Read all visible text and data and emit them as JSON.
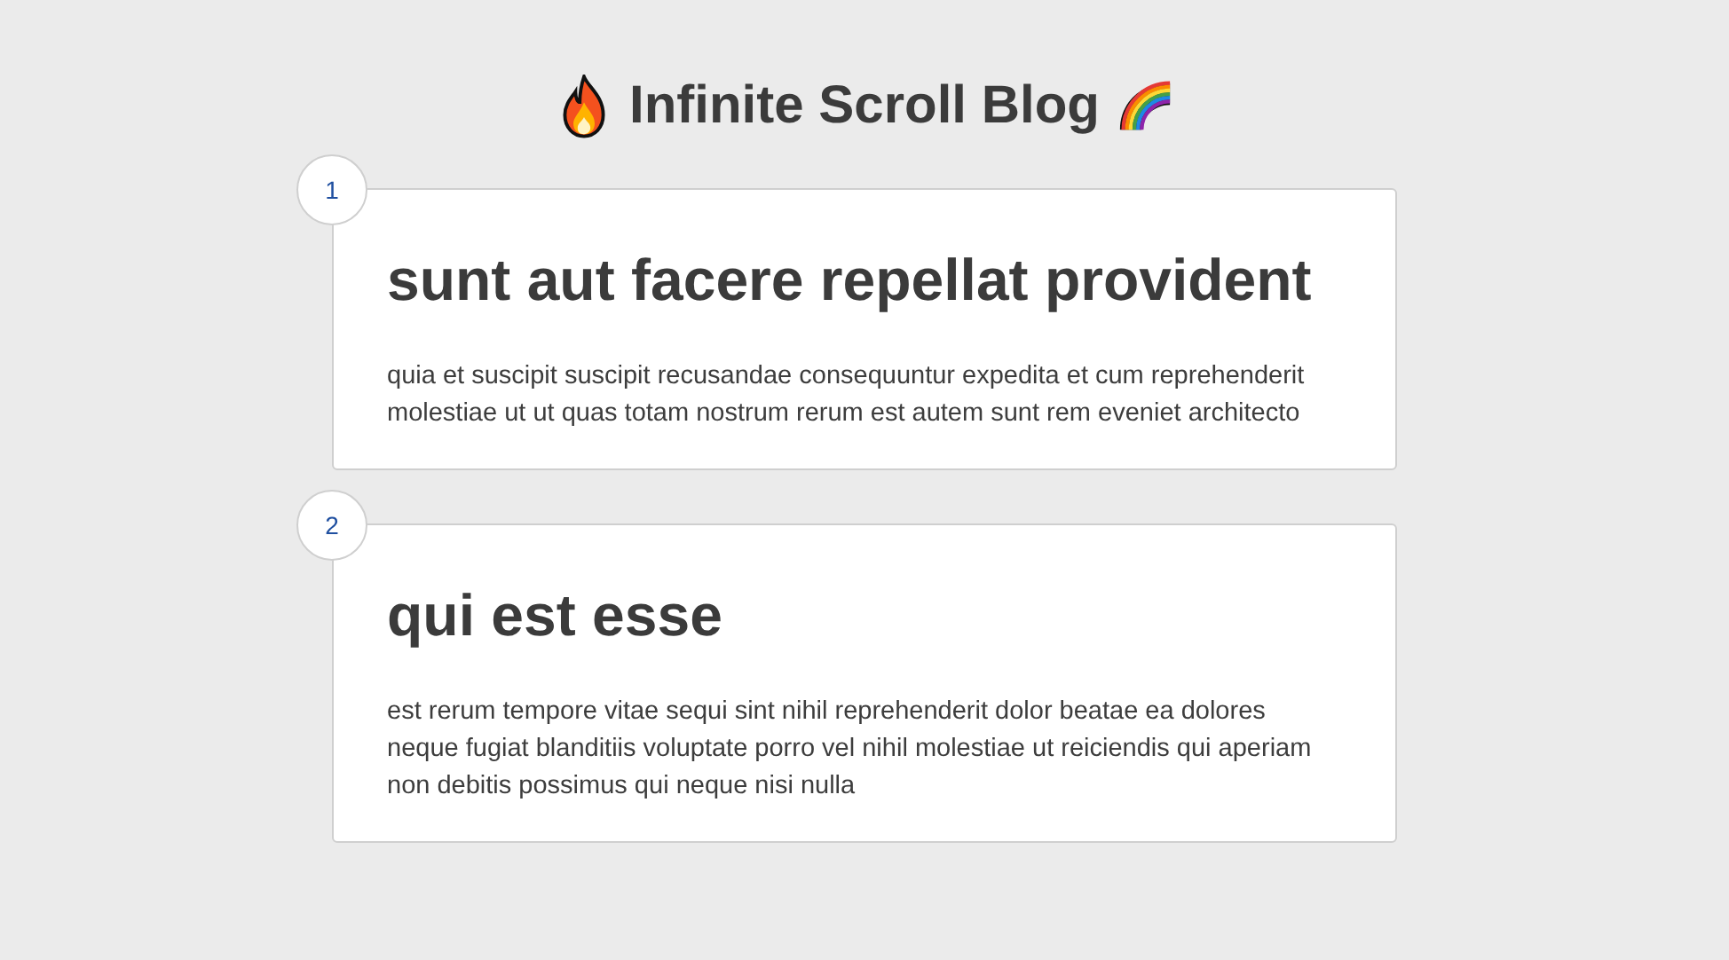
{
  "header": {
    "title": "Infinite Scroll Blog"
  },
  "posts": [
    {
      "number": "1",
      "title": "sunt aut facere repellat provident",
      "body": "quia et suscipit suscipit recusandae consequuntur expedita et cum reprehenderit molestiae ut ut quas totam nostrum rerum est autem sunt rem eveniet architecto"
    },
    {
      "number": "2",
      "title": "qui est esse",
      "body": "est rerum tempore vitae sequi sint nihil reprehenderit dolor beatae ea dolores neque fugiat blanditiis voluptate porro vel nihil molestiae ut reiciendis qui aperiam non debitis possimus qui neque nisi nulla"
    }
  ]
}
